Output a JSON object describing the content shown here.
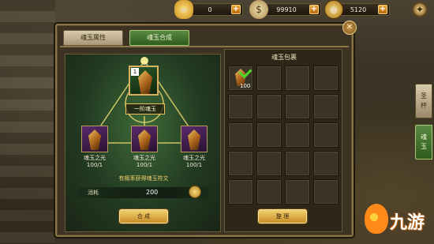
{
  "topbar": {
    "currencies": [
      {
        "icon": "gold-ingot-icon",
        "value": "0"
      },
      {
        "icon": "money-bag-icon",
        "value": "99910"
      },
      {
        "icon": "coin-icon",
        "value": "5120"
      }
    ],
    "plus_label": "+",
    "settings_icon": "gear-icon"
  },
  "tabs": [
    "魂玉属性",
    "魂玉合成"
  ],
  "active_tab": "魂玉合成",
  "compose": {
    "result": {
      "badge": "1",
      "name": "一阶魂玉"
    },
    "materials": [
      {
        "name": "魂玉之光",
        "count": "100/1"
      },
      {
        "name": "魂玉之光",
        "count": "100/1"
      },
      {
        "name": "魂玉之光",
        "count": "100/1"
      }
    ],
    "hint": "有概率获得魂玉符文",
    "cost_label": "消耗",
    "cost_value": "200",
    "compose_button": "合 成"
  },
  "bag": {
    "title": "魂玉包裹",
    "items": [
      {
        "count": "100",
        "selected": true
      }
    ],
    "sort_button": "整 理"
  },
  "side_tabs": [
    {
      "label": "圣\n杯",
      "active": false
    },
    {
      "label": "魂\n玉",
      "active": true
    }
  ],
  "watermark": "九游",
  "colors": {
    "accent_gold": "#f2d070",
    "tab_active": "#3a6a2a",
    "check_green": "#4ad82a"
  }
}
